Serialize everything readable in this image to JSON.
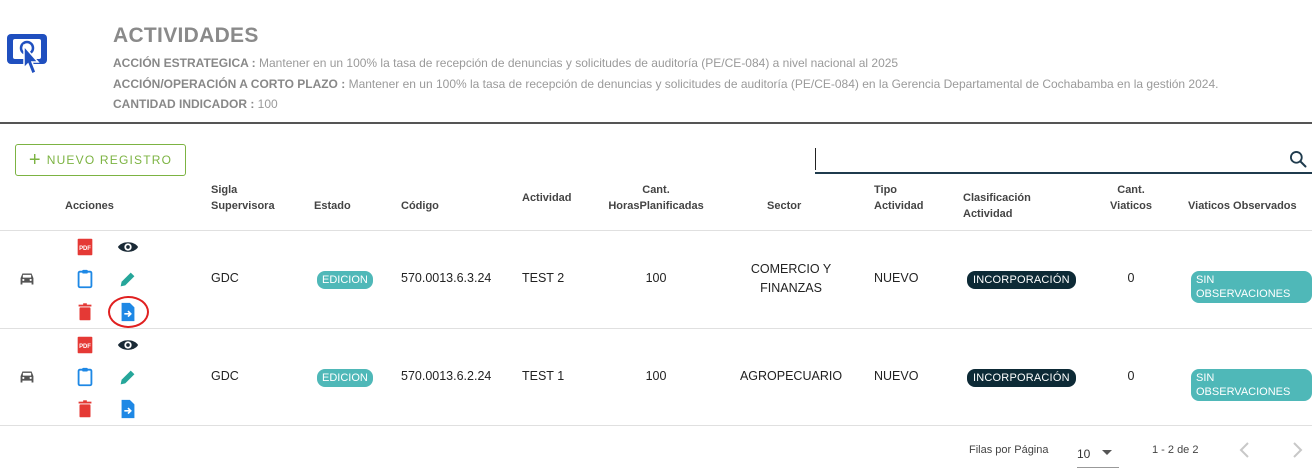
{
  "header": {
    "title": "ACTIVIDADES",
    "accion_estrategica_label": "ACCIÓN ESTRATEGICA :",
    "accion_estrategica_value": "Mantener en un 100% la tasa de recepción de denuncias y solicitudes de auditoría (PE/CE-084) a nivel nacional al 2025",
    "accion_operacion_label": "ACCIÓN/OPERACIÓN A CORTO PLAZO :",
    "accion_operacion_value": "Mantener en un 100% la tasa de recepción de denuncias y solicitudes de auditoría (PE/CE-084) en la Gerencia Departamental de Cochabamba en la gestión 2024.",
    "cantidad_label": "CANTIDAD INDICADOR :",
    "cantidad_value": "100"
  },
  "toolbar": {
    "new_button_label": "NUEVO REGISTRO",
    "search_placeholder": ""
  },
  "table": {
    "headers": {
      "acciones": "Acciones",
      "sigla_1": "Sigla",
      "sigla_2": "Supervisora",
      "estado": "Estado",
      "codigo": "Código",
      "actividad": "Actividad",
      "horas_1": "Cant.",
      "horas_2": "HorasPlanificadas",
      "sector": "Sector",
      "tipo_1": "Tipo",
      "tipo_2": "Actividad",
      "clasif_1": "Clasificación",
      "clasif_2": "Actividad",
      "viaticos_1": "Cant.",
      "viaticos_2": "Viaticos",
      "obs": "Viaticos Observados"
    },
    "rows": [
      {
        "sigla": "GDC",
        "estado": "EDICION",
        "codigo": "570.0013.6.3.24",
        "actividad": "TEST 2",
        "horas": "100",
        "sector_1": "COMERCIO Y",
        "sector_2": "FINANZAS",
        "tipo": "NUEVO",
        "clasificacion": "INCORPORACIÓN",
        "viaticos": "0",
        "observados": "SIN OBSERVACIONES"
      },
      {
        "sigla": "GDC",
        "estado": "EDICION",
        "codigo": "570.0013.6.2.24",
        "actividad": "TEST 1",
        "horas": "100",
        "sector_1": "AGROPECUARIO",
        "sector_2": "",
        "tipo": "NUEVO",
        "clasificacion": "INCORPORACIÓN",
        "viaticos": "0",
        "observados": "SIN OBSERVACIONES"
      }
    ]
  },
  "footer": {
    "rows_per_page_label": "Filas por Página",
    "rows_per_page_value": "10",
    "range": "1 - 2 de 2"
  },
  "icons": {
    "logo": "touch-screen-icon",
    "search": "search-icon",
    "car": "car-icon",
    "pdf": "pdf-icon",
    "view": "eye-icon",
    "clipboard": "clipboard-icon",
    "edit": "pencil-icon",
    "delete": "trash-icon",
    "export": "file-export-icon",
    "dropdown": "caret-down-icon",
    "prev": "chevron-left-icon",
    "next": "chevron-right-icon"
  },
  "colors": {
    "accent_green": "#7cb342",
    "teal_badge": "#4fb8b8",
    "dark_badge": "#0d2a36",
    "pdf_red": "#e53935",
    "action_blue": "#1e88e5",
    "edit_teal": "#26a69a"
  }
}
